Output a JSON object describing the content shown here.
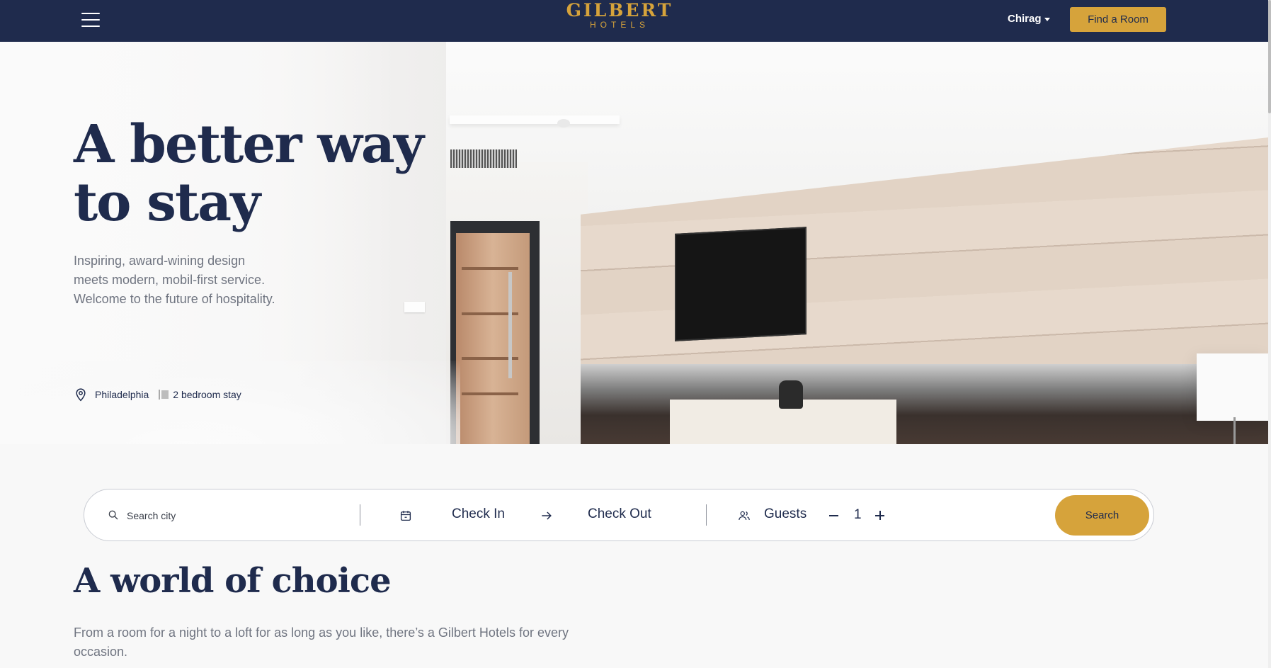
{
  "nav": {
    "menu_icon": "hamburger-menu-icon",
    "brand_name": "GILBERT",
    "brand_sub": "HOTELS",
    "user_name": "Chirag",
    "cta_label": "Find a Room",
    "colors": {
      "background": "#1f2b4d",
      "accent": "#d6a33b"
    }
  },
  "hero": {
    "title_line1": "A better way",
    "title_line2": "to stay",
    "desc_line1": "Inspiring, award-wining design",
    "desc_line2": "meets modern, mobil-first service.",
    "desc_line3": "Welcome to the future of hospitality.",
    "location_icon": "map-pin-icon",
    "location": "Philadelphia",
    "stay_type": "2 bedroom stay"
  },
  "search": {
    "search_icon": "search-icon",
    "city_placeholder": "Search city",
    "calendar_icon": "calendar-icon",
    "check_in": "Check In",
    "arrow_icon": "arrow-right-icon",
    "check_out": "Check Out",
    "guests_icon": "users-icon",
    "guests_label": "Guests",
    "guest_count": "1",
    "button_label": "Search"
  },
  "section": {
    "title": "A world of choice",
    "desc": "From a room for a night to a loft for as long as you like, there’s a Gilbert Hotels for every occasion."
  }
}
